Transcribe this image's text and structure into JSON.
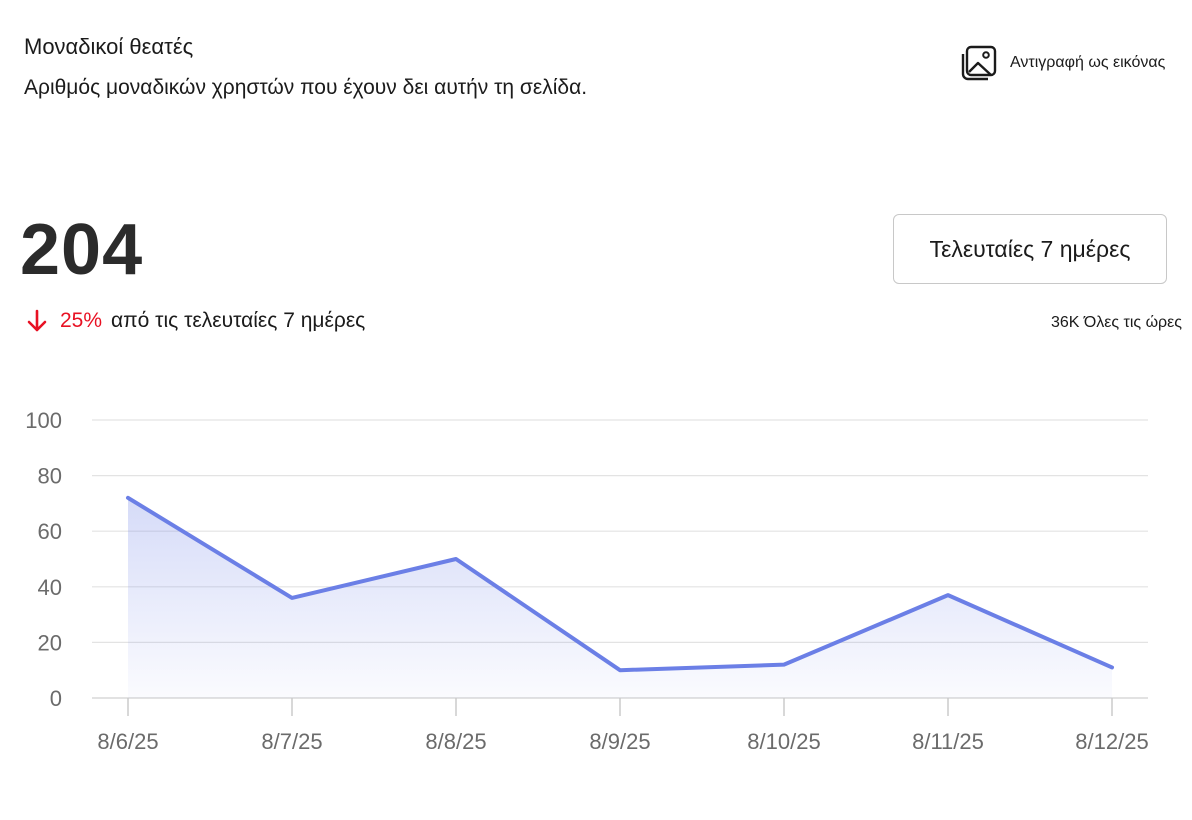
{
  "header": {
    "title": "Μοναδικοί θεατές",
    "subtitle": "Αριθμός μοναδικών χρηστών που έχουν δει αυτήν τη σελίδα.",
    "copy_label": "Αντιγραφή ως εικόνας"
  },
  "summary": {
    "value": "204",
    "change_pct": "25%",
    "change_direction": "down",
    "change_context": "από τις τελευταίες 7 ημέρες",
    "range_button": "Τελευταίες 7 ημέρες",
    "all_time": "36K Όλες τις ώρες"
  },
  "colors": {
    "line": "#6b7fe6",
    "decrease": "#e81123",
    "grid": "#e3e3e3"
  },
  "chart_data": {
    "type": "area",
    "categories": [
      "8/6/25",
      "8/7/25",
      "8/8/25",
      "8/9/25",
      "8/10/25",
      "8/11/25",
      "8/12/25"
    ],
    "values": [
      72,
      36,
      50,
      10,
      12,
      37,
      11
    ],
    "ylim": [
      0,
      100
    ],
    "yticks": [
      0,
      20,
      40,
      60,
      80,
      100
    ],
    "grid": true,
    "legend": "none"
  }
}
